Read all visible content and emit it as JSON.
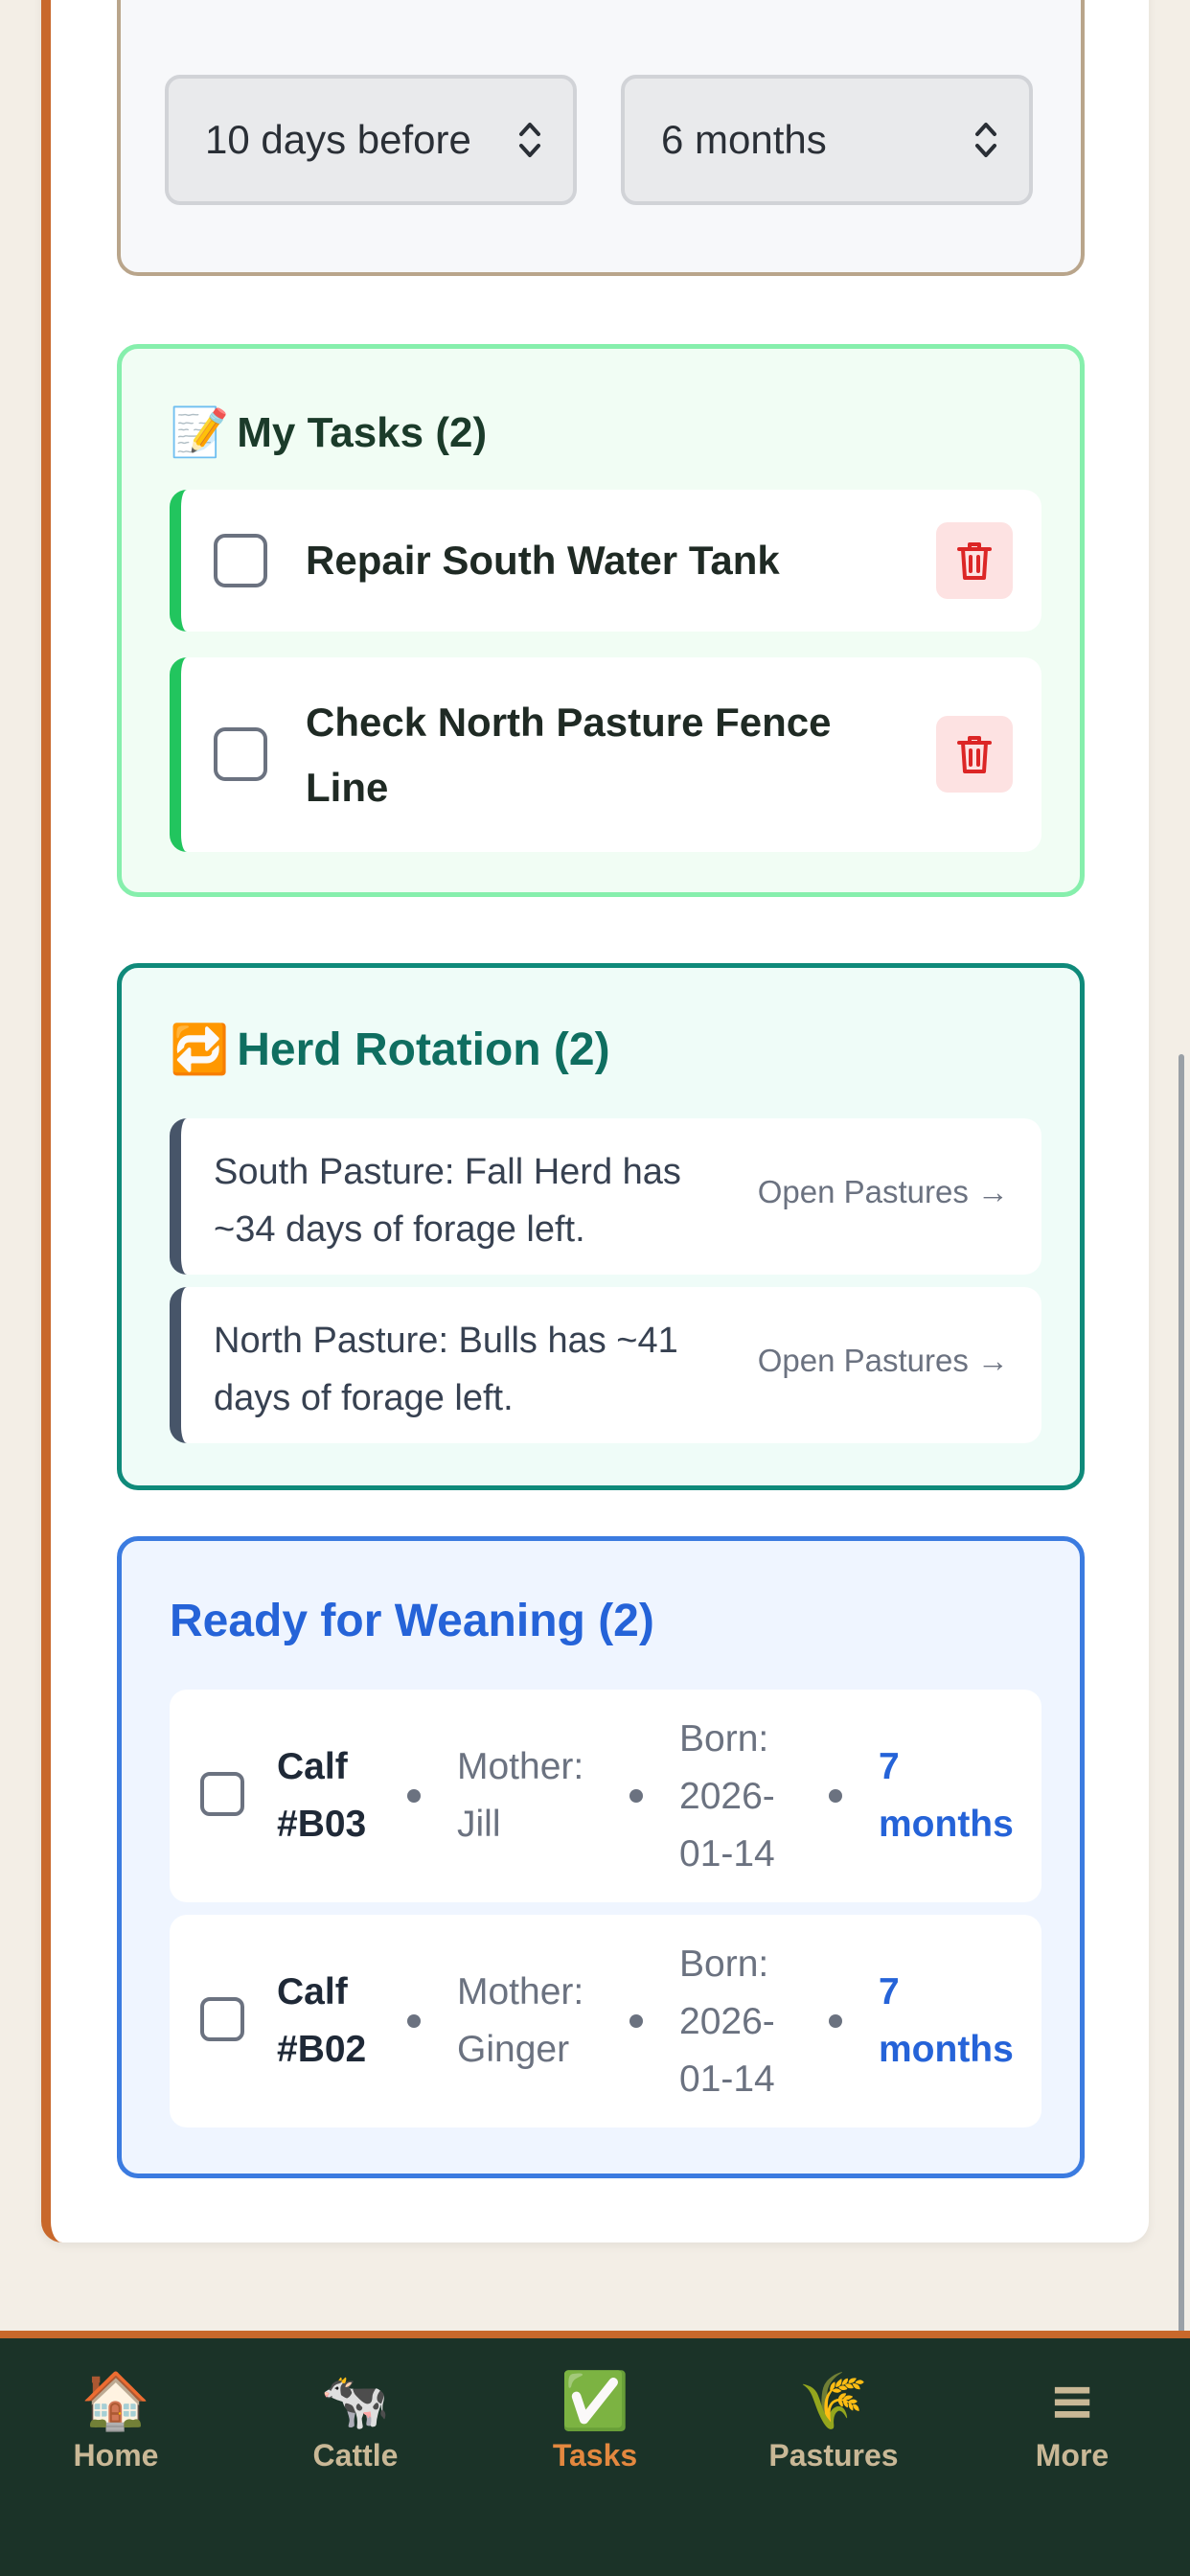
{
  "reminder": {
    "select_before": "10 days before",
    "select_duration": "6 months"
  },
  "tasks": {
    "icon": "📝",
    "title": "My Tasks (2)",
    "items": [
      {
        "label": "Repair South Water Tank"
      },
      {
        "label_line1": "Check North Pasture Fence",
        "label_line2": "Line"
      }
    ]
  },
  "rotation": {
    "icon": "🔁",
    "title": "Herd Rotation (2)",
    "items": [
      {
        "line1": "South Pasture: Fall Herd has",
        "line2": "~34 days of forage left.",
        "link": "Open Pastures →"
      },
      {
        "line1": "North Pasture: Bulls has ~41",
        "line2": "days of forage left.",
        "link": "Open Pastures →"
      }
    ]
  },
  "weaning": {
    "title": "Ready for Weaning (2)",
    "items": [
      {
        "calf1": "Calf",
        "calf2": "#B03",
        "mother1": "Mother:",
        "mother2": "Jill",
        "born1": "Born:",
        "born2": "2026-",
        "born3": "01-14",
        "age1": "7",
        "age2": "months"
      },
      {
        "calf1": "Calf",
        "calf2": "#B02",
        "mother1": "Mother:",
        "mother2": "Ginger",
        "born1": "Born:",
        "born2": "2026-",
        "born3": "01-14",
        "age1": "7",
        "age2": "months"
      }
    ]
  },
  "nav": {
    "items": [
      {
        "icon": "🏠",
        "label": "Home"
      },
      {
        "icon": "🐄",
        "label": "Cattle"
      },
      {
        "icon": "✅",
        "label": "Tasks"
      },
      {
        "icon": "🌾",
        "label": "Pastures"
      },
      {
        "icon": "≡",
        "label": "More"
      }
    ]
  },
  "colors": {
    "accent": "#c8682b",
    "nav_bg": "#1b3328",
    "tasks_border": "#86efac",
    "rotation_border": "#0f8a7a",
    "weaning_border": "#3b7be0"
  }
}
